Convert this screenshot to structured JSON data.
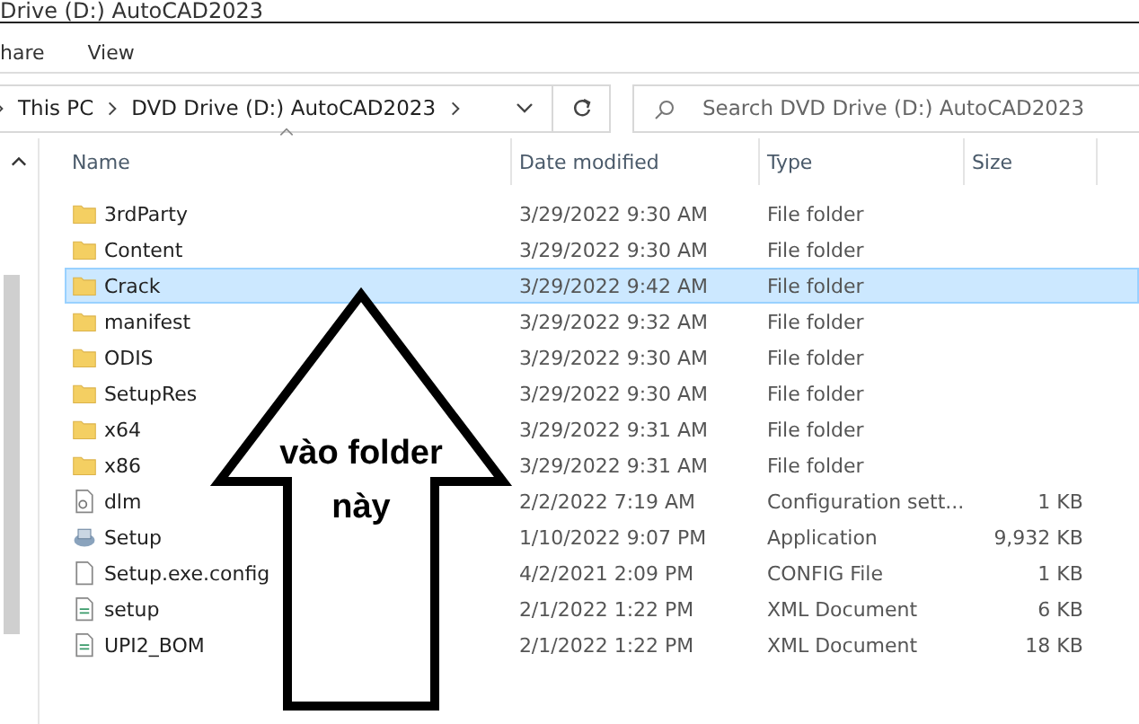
{
  "window": {
    "title": "Drive (D:) AutoCAD2023"
  },
  "ribbon_tabs": [
    "hare",
    "View"
  ],
  "address_bar": {
    "path": [
      "This PC",
      "DVD Drive (D:) AutoCAD2023"
    ]
  },
  "search": {
    "placeholder": "Search DVD Drive (D:) AutoCAD2023"
  },
  "columns": [
    "Name",
    "Date modified",
    "Type",
    "Size"
  ],
  "rows": [
    {
      "kind": "folder",
      "name": "3rdParty",
      "date": "3/29/2022 9:30 AM",
      "type": "File folder",
      "size": "",
      "selected": false
    },
    {
      "kind": "folder",
      "name": "Content",
      "date": "3/29/2022 9:30 AM",
      "type": "File folder",
      "size": "",
      "selected": false
    },
    {
      "kind": "folder",
      "name": "Crack",
      "date": "3/29/2022 9:42 AM",
      "type": "File folder",
      "size": "",
      "selected": true
    },
    {
      "kind": "folder",
      "name": "manifest",
      "date": "3/29/2022 9:32 AM",
      "type": "File folder",
      "size": "",
      "selected": false
    },
    {
      "kind": "folder",
      "name": "ODIS",
      "date": "3/29/2022 9:30 AM",
      "type": "File folder",
      "size": "",
      "selected": false
    },
    {
      "kind": "folder",
      "name": "SetupRes",
      "date": "3/29/2022 9:30 AM",
      "type": "File folder",
      "size": "",
      "selected": false
    },
    {
      "kind": "folder",
      "name": "x64",
      "date": "3/29/2022 9:31 AM",
      "type": "File folder",
      "size": "",
      "selected": false
    },
    {
      "kind": "folder",
      "name": "x86",
      "date": "3/29/2022 9:31 AM",
      "type": "File folder",
      "size": "",
      "selected": false
    },
    {
      "kind": "settings",
      "name": "dlm",
      "date": "2/2/2022 7:19 AM",
      "type": "Configuration sett...",
      "size": "1 KB",
      "selected": false
    },
    {
      "kind": "app",
      "name": "Setup",
      "date": "1/10/2022 9:07 PM",
      "type": "Application",
      "size": "9,932 KB",
      "selected": false
    },
    {
      "kind": "file",
      "name": "Setup.exe.config",
      "date": "4/2/2021 2:09 PM",
      "type": "CONFIG File",
      "size": "1 KB",
      "selected": false
    },
    {
      "kind": "xml",
      "name": "setup",
      "date": "2/1/2022 1:22 PM",
      "type": "XML Document",
      "size": "6 KB",
      "selected": false
    },
    {
      "kind": "xml",
      "name": "UPI2_BOM",
      "date": "2/1/2022 1:22 PM",
      "type": "XML Document",
      "size": "18 KB",
      "selected": false
    }
  ],
  "callout": {
    "text": "vào folder này"
  }
}
